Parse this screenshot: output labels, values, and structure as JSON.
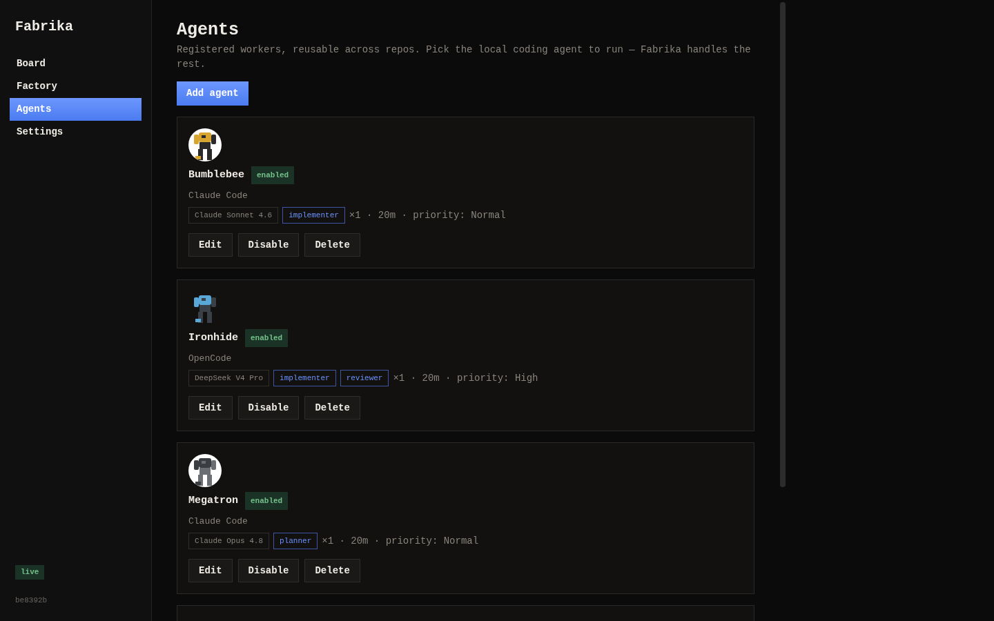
{
  "sidebar": {
    "brand": "Fabrika",
    "items": [
      {
        "label": "Board",
        "selected": false
      },
      {
        "label": "Factory",
        "selected": false
      },
      {
        "label": "Agents",
        "selected": true
      },
      {
        "label": "Settings",
        "selected": false
      }
    ],
    "status_badge": "live",
    "version": "be8392b"
  },
  "page": {
    "title": "Agents",
    "description": "Registered workers, reusable across repos. Pick the local coding agent to run — Fabrika handles the rest.",
    "add_button": "Add agent"
  },
  "agents": [
    {
      "name": "Bumblebee",
      "status": {
        "label": "enabled",
        "enabled": true
      },
      "runtime": "Claude Code",
      "model": "Claude Sonnet 4.6",
      "roles": [
        "implementer"
      ],
      "meta": "×1 · 20m · priority: Normal",
      "actions": [
        "Edit",
        "Disable",
        "Delete"
      ]
    },
    {
      "name": "Ironhide",
      "status": {
        "label": "enabled",
        "enabled": true
      },
      "runtime": "OpenCode",
      "model": "DeepSeek V4 Pro",
      "roles": [
        "implementer",
        "reviewer"
      ],
      "meta": "×1 · 20m · priority: High",
      "actions": [
        "Edit",
        "Disable",
        "Delete"
      ]
    },
    {
      "name": "Megatron",
      "status": {
        "label": "enabled",
        "enabled": true
      },
      "runtime": "Claude Code",
      "model": "Claude Opus 4.8",
      "roles": [
        "planner"
      ],
      "meta": "×1 · 20m · priority: Normal",
      "actions": [
        "Edit",
        "Disable",
        "Delete"
      ]
    }
  ]
}
